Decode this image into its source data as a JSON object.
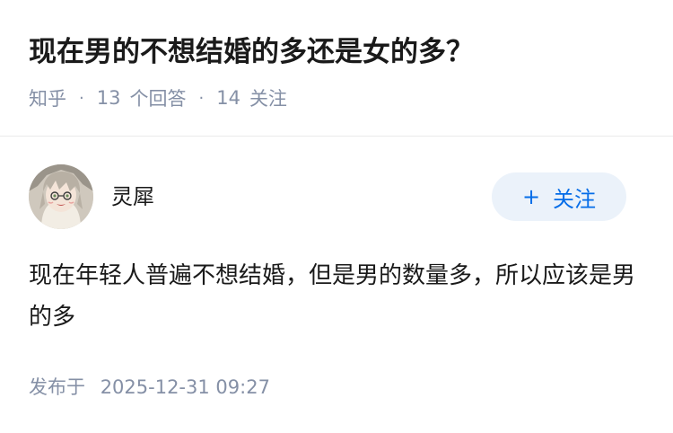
{
  "question": {
    "title": "现在男的不想结婚的多还是女的多？",
    "source": "知乎",
    "answer_count": "13",
    "answer_label": "个回答",
    "follower_count": "14",
    "follower_label": "关注"
  },
  "author": {
    "name": "灵犀",
    "follow_label": "关注",
    "follow_icon": "+"
  },
  "answer": {
    "content": "现在年轻人普遍不想结婚，但是男的数量多，所以应该是男的多",
    "published_label": "发布于",
    "published_time": "2025-12-31 09:27"
  },
  "colors": {
    "accent": "#056de8",
    "follow_bg": "#ebf2fa",
    "meta_text": "#8590a6"
  }
}
